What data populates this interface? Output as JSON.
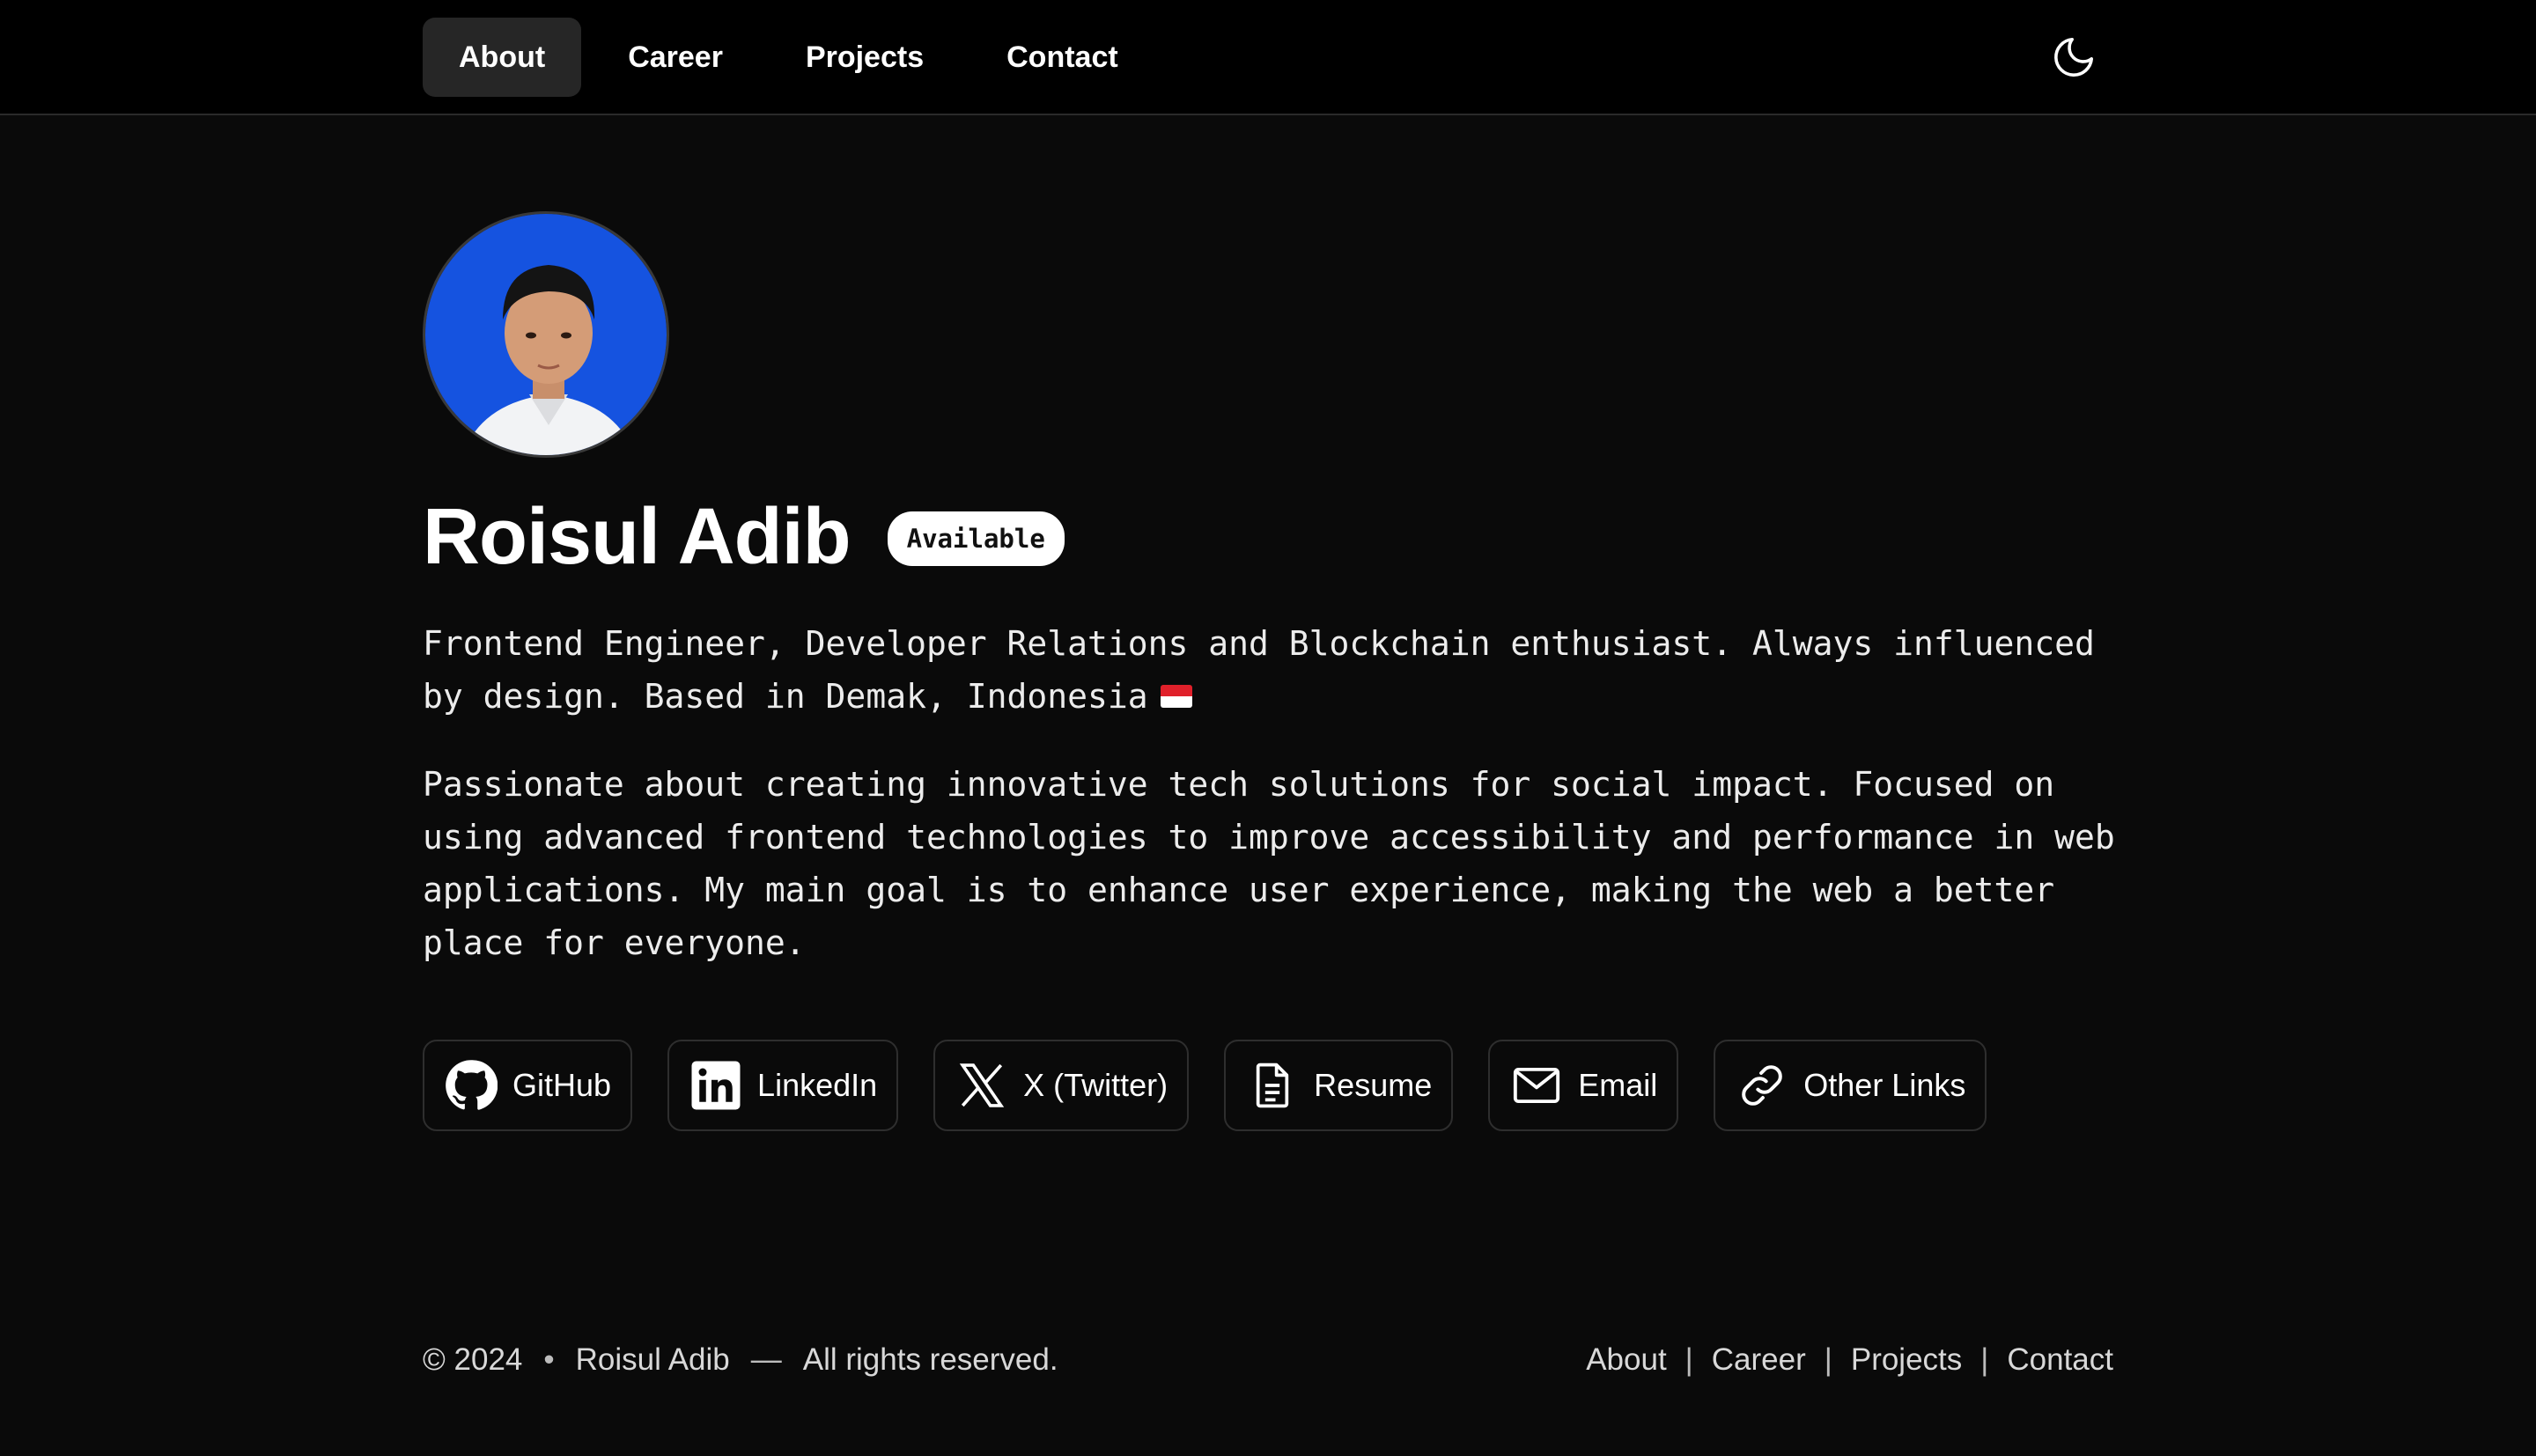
{
  "nav": {
    "items": [
      {
        "label": "About",
        "active": true
      },
      {
        "label": "Career",
        "active": false
      },
      {
        "label": "Projects",
        "active": false
      },
      {
        "label": "Contact",
        "active": false
      }
    ],
    "theme_icon": "moon-icon"
  },
  "profile": {
    "name": "Roisul Adib",
    "status_badge": "Available",
    "tagline": "Frontend Engineer, Developer Relations and Blockchain enthusiast. Always influenced by design. Based in Demak, Indonesia",
    "bio": "Passionate about creating innovative tech solutions for social impact. Focused on using advanced frontend technologies to improve accessibility and performance in web applications. My main goal is to enhance user experience, making the web a better place for everyone."
  },
  "links": [
    {
      "label": "GitHub",
      "icon": "github-icon"
    },
    {
      "label": "LinkedIn",
      "icon": "linkedin-icon"
    },
    {
      "label": "X (Twitter)",
      "icon": "x-twitter-icon"
    },
    {
      "label": "Resume",
      "icon": "document-icon"
    },
    {
      "label": "Email",
      "icon": "mail-icon"
    },
    {
      "label": "Other Links",
      "icon": "link-icon"
    }
  ],
  "footer": {
    "copyright": "© 2024",
    "bullet": "•",
    "author": "Roisul Adib",
    "dash": "—",
    "rights": "All rights reserved.",
    "nav": [
      "About",
      "Career",
      "Projects",
      "Contact"
    ],
    "separator": "|"
  },
  "colors": {
    "background": "#0a0a0a",
    "topbar": "#000000",
    "active_tab": "#262626",
    "avatar_bg": "#1553e0",
    "badge_bg": "#ffffff"
  }
}
